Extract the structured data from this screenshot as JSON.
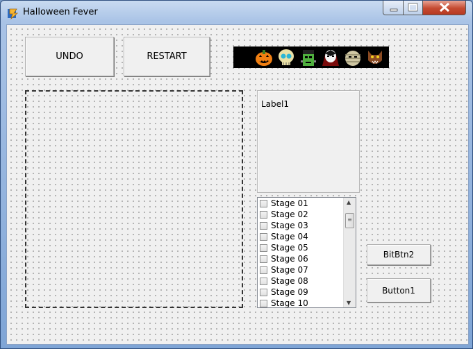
{
  "window": {
    "title": "Halloween Fever"
  },
  "toolbar": {
    "undo_label": "UNDO",
    "restart_label": "RESTART"
  },
  "banner": {
    "icons": [
      "pumpkin-icon",
      "skull-icon",
      "frankenstein-icon",
      "vampire-icon",
      "mummy-icon",
      "werewolf-icon"
    ]
  },
  "label_panel": {
    "text": "Label1"
  },
  "stages": [
    "Stage 01",
    "Stage 02",
    "Stage 03",
    "Stage 04",
    "Stage 05",
    "Stage 06",
    "Stage 07",
    "Stage 08",
    "Stage 09",
    "Stage 10"
  ],
  "buttons": {
    "bitbtn_label": "BitBtn2",
    "button1_label": "Button1"
  },
  "colors": {
    "client_bg": "#f0f0f0",
    "banner_bg": "#000000",
    "close_red": "#c44a31"
  }
}
